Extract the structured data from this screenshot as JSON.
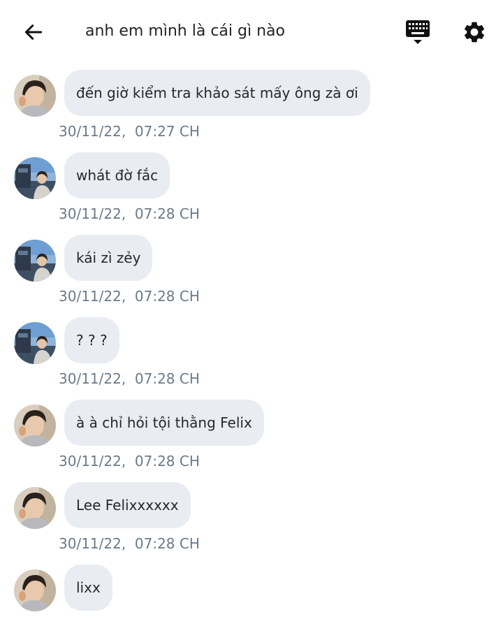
{
  "header": {
    "title": "anh em mình là cái gì nào",
    "back_icon": "arrow-left-icon",
    "keyboard_icon": "keyboard-icon",
    "settings_icon": "gear-icon"
  },
  "messages": [
    {
      "text": "đến giờ kiểm tra khảo sát mấy ông zà ơi",
      "time": "30/11/22,  07:27 CH",
      "avatar": "person-a"
    },
    {
      "text": "whát đờ fắc",
      "time": "30/11/22,  07:28 CH",
      "avatar": "person-b"
    },
    {
      "text": "kái zì zẻy",
      "time": "30/11/22,  07:28 CH",
      "avatar": "person-b"
    },
    {
      "text": "? ? ?",
      "time": "30/11/22,  07:28 CH",
      "avatar": "person-b"
    },
    {
      "text": "à à chỉ hỏi tội thằng Felix",
      "time": "30/11/22,  07:28 CH",
      "avatar": "person-a"
    },
    {
      "text": "Lee Felixxxxxx",
      "time": "30/11/22,  07:28 CH",
      "avatar": "person-a"
    },
    {
      "text": "lixx",
      "avatar": "person-a"
    }
  ],
  "colors": {
    "bubble": "#e9edf1",
    "timestamp": "#6b7a8a",
    "icon": "#111111"
  }
}
